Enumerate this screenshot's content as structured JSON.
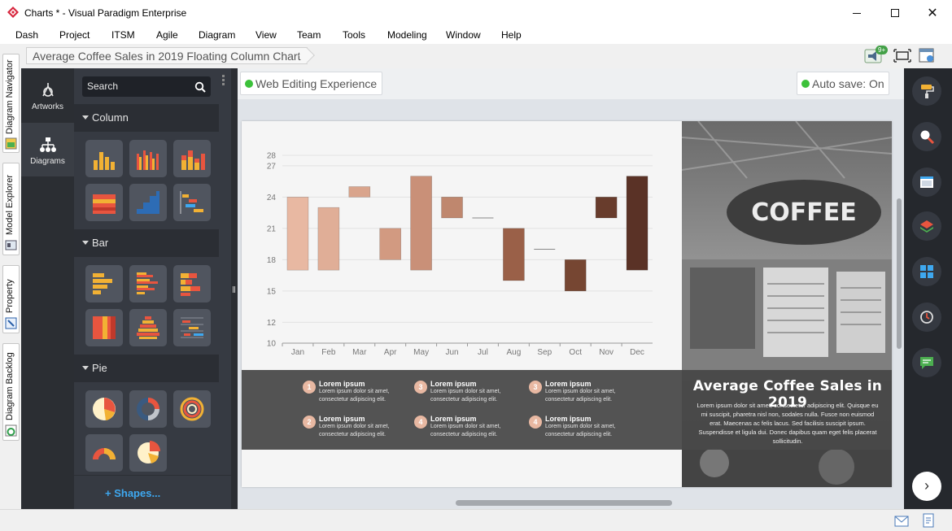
{
  "window": {
    "title": "Charts * - Visual Paradigm Enterprise",
    "controls": [
      "minimize",
      "maximize",
      "close"
    ]
  },
  "menu": [
    "Dash",
    "Project",
    "ITSM",
    "Agile",
    "Diagram",
    "View",
    "Team",
    "Tools",
    "Modeling",
    "Window",
    "Help"
  ],
  "breadcrumb": "Average Coffee Sales in 2019 Floating Column Chart",
  "notification_badge": "9+",
  "left_tabs": [
    "Diagram Navigator",
    "Model Explorer",
    "Property",
    "Diagram Backlog"
  ],
  "nav": [
    {
      "label": "Artworks",
      "icon": "artworks-icon"
    },
    {
      "label": "Diagrams",
      "icon": "diagrams-icon"
    }
  ],
  "search": {
    "placeholder": "Search"
  },
  "categories": [
    {
      "label": "Column",
      "tiles": 6
    },
    {
      "label": "Bar",
      "tiles": 6
    },
    {
      "label": "Pie",
      "tiles": 5
    }
  ],
  "shapes_link": "+ Shapes...",
  "canvas": {
    "web_editing": "Web Editing Experience",
    "autosave": "Auto save: On"
  },
  "colors": {
    "accent_green": "#3cc13a",
    "dark_panel": "#363a42",
    "link_blue": "#3ea8f0",
    "bar_light": "#e8b8a2",
    "bar_dark": "#5a3226"
  },
  "chart_data": {
    "type": "floating-column",
    "categories": [
      "Jan",
      "Feb",
      "Mar",
      "Apr",
      "May",
      "Jun",
      "Jul",
      "Aug",
      "Sep",
      "Oct",
      "Nov",
      "Dec"
    ],
    "ranges": [
      [
        17,
        24
      ],
      [
        17,
        23
      ],
      [
        24,
        25
      ],
      [
        18,
        21
      ],
      [
        17,
        26
      ],
      [
        22,
        24
      ],
      [
        22,
        22
      ],
      [
        16,
        21
      ],
      [
        19,
        19
      ],
      [
        15,
        18
      ],
      [
        22,
        24
      ],
      [
        17,
        26
      ]
    ],
    "colors": [
      "#e8b8a2",
      "#e0ae97",
      "#d9a48c",
      "#d29a81",
      "#c99078",
      "#bf876e",
      "#b57e65",
      "#9a6048",
      "#8a5540",
      "#764632",
      "#683c2c",
      "#5a3226"
    ],
    "yticks": [
      10,
      12,
      15,
      18,
      21,
      24,
      27,
      28
    ],
    "ylim": [
      10,
      28
    ],
    "grid": true
  },
  "poster": {
    "title": "Average Coffee Sales in 2019",
    "description": "Lorem ipsum dolor sit amet, consectetur adipiscing elit. Quisque eu mi suscipit, pharetra nisl non, sodales nulla. Fusce non euismod erat. Maecenas ac felis lacus. Sed facilisis suscipit ipsum. Suspendisse et ligula dui. Donec dapibus quam eget felis placerat sollicitudin.",
    "items": [
      {
        "num": "1",
        "title": "Lorem ipsum",
        "text": "Lorem ipsum dolor sit amet, consectetur adipiscing elit."
      },
      {
        "num": "2",
        "title": "Lorem ipsum",
        "text": "Lorem ipsum dolor sit amet, consectetur adipiscing elit."
      },
      {
        "num": "3",
        "title": "Lorem ipsum",
        "text": "Lorem ipsum dolor sit amet, consectetur adipiscing elit."
      },
      {
        "num": "4",
        "title": "Lorem ipsum",
        "text": "Lorem ipsum dolor sit amet, consectetur adipiscing elit."
      },
      {
        "num": "3",
        "title": "Lorem ipsum",
        "text": "Lorem ipsum dolor sit amet, consectetur adipiscing elit."
      },
      {
        "num": "4",
        "title": "Lorem ipsum",
        "text": "Lorem ipsum dolor sit amet, consectetur adipiscing elit."
      }
    ]
  }
}
